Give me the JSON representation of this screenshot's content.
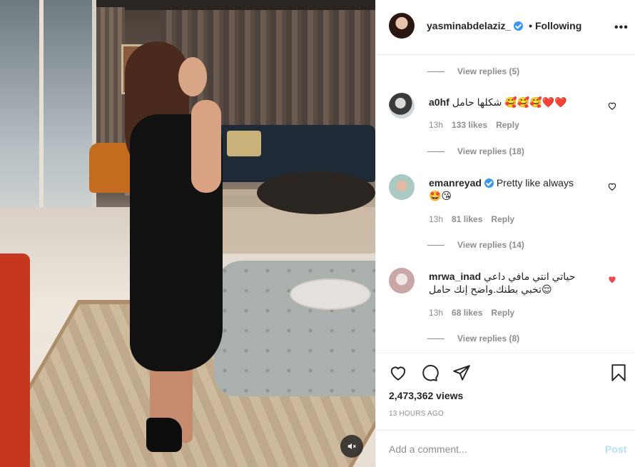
{
  "post": {
    "author": "yasminabdelaziz_",
    "follow_separator": "•",
    "follow_label": "Following",
    "more_label": "•••",
    "views": "2,473,362 views",
    "time_ago": "13 HOURS AGO"
  },
  "comments": [
    {
      "type": "replies",
      "label": "View replies (5)"
    },
    {
      "type": "comment",
      "user": "a0hf",
      "text": "شكلها حامل 🥰🥰🥰❤️❤️",
      "time": "13h",
      "likes": "133 likes",
      "reply": "Reply",
      "liked": false
    },
    {
      "type": "replies",
      "label": "View replies (18)"
    },
    {
      "type": "comment",
      "user": "emanreyad",
      "verified": true,
      "text": "Pretty like always",
      "text2": "🤩😘",
      "time": "13h",
      "likes": "81 likes",
      "reply": "Reply",
      "liked": false
    },
    {
      "type": "replies",
      "label": "View replies (14)"
    },
    {
      "type": "comment",
      "user": "mrwa_inad",
      "text": "حياتي انتي مافي داعي",
      "text2": "تخبي بطنك.واضح إنك حامل😌",
      "time": "13h",
      "likes": "68 likes",
      "reply": "Reply",
      "liked": true
    },
    {
      "type": "replies",
      "label": "View replies (8)"
    }
  ],
  "add_comment": {
    "placeholder": "Add a comment...",
    "post_label": "Post"
  },
  "colors": {
    "like_red": "#ed4956",
    "verified_blue": "#3897f0",
    "muted": "#8e8e8e",
    "post_disabled": "#b2dffc"
  },
  "icons": {
    "mute": "speaker-muted-icon",
    "like": "heart-icon",
    "comment": "speech-bubble-icon",
    "share": "paper-plane-icon",
    "save": "bookmark-icon"
  }
}
